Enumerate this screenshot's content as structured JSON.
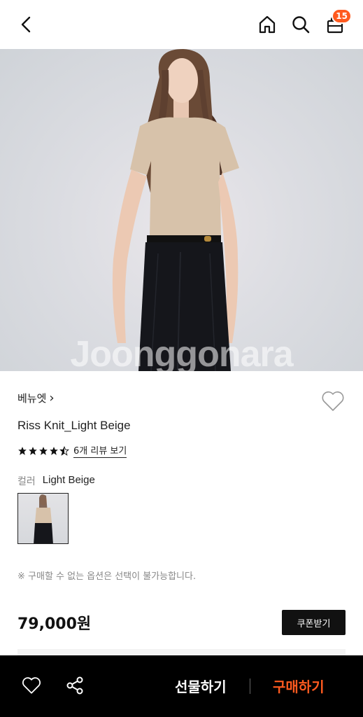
{
  "header": {
    "back_icon": "chevron-left-icon",
    "home_icon": "home-icon",
    "search_icon": "search-icon",
    "cart_icon": "shopping-bag-icon",
    "cart_count": "15"
  },
  "hero": {
    "watermark": "Joonggonara"
  },
  "product": {
    "brand": "베뉴엣",
    "brand_chevron": "›",
    "title": "Riss Knit_Light Beige",
    "rating": 4.5,
    "review_link": "6개 리뷰 보기",
    "color_label": "컬러",
    "color_value": "Light Beige",
    "notice": "※ 구매할 수 없는 옵션은 선택이 불가능합니다.",
    "price": "79,000원",
    "coupon_label": "쿠폰받기"
  },
  "bottom_bar": {
    "gift_label": "선물하기",
    "buy_label": "구매하기"
  },
  "colors": {
    "accent": "#ff5a1f",
    "bottom_bar_bg": "#000000",
    "coupon_bg": "#111111"
  }
}
